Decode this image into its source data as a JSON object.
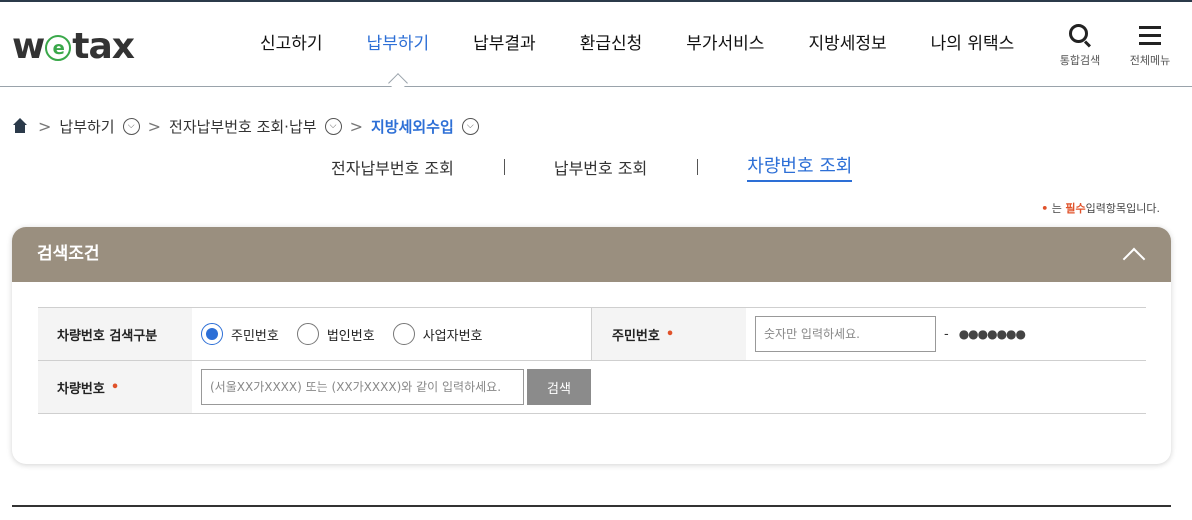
{
  "header": {
    "logo_pre": "w",
    "logo_e": "e",
    "logo_post": "tax",
    "nav": [
      "신고하기",
      "납부하기",
      "납부결과",
      "환급신청",
      "부가서비스",
      "지방세정보",
      "나의 위택스"
    ],
    "active_nav": "납부하기",
    "search_label": "통합검색",
    "menu_label": "전체메뉴"
  },
  "breadcrumb": {
    "items": [
      "납부하기",
      "전자납부번호 조회·납부",
      "지방세외수입"
    ],
    "separator": ">"
  },
  "tabs": {
    "items": [
      "전자납부번호 조회",
      "납부번호 조회",
      "차량번호 조회"
    ],
    "active": "차량번호 조회"
  },
  "required_note": {
    "bullet": "•",
    "pre": "는",
    "highlight": "필수",
    "post": "입력항목입니다."
  },
  "panel": {
    "title": "검색조건",
    "form": {
      "row1": {
        "label": "차량번호 검색구분",
        "options": [
          "주민번호",
          "법인번호",
          "사업자번호"
        ],
        "selected": "주민번호",
        "id_label": "주민번호",
        "required_mark": "•",
        "id_placeholder": "숫자만 입력하세요.",
        "dash": "-",
        "masked": "●●●●●●●"
      },
      "row2": {
        "label": "차량번호",
        "required_mark": "•",
        "placeholder": "(서울XX가XXXX) 또는 (XX가XXXX)와 같이 입력하세요.",
        "search_button": "검색"
      }
    }
  },
  "colors": {
    "accent": "#2d6fd6",
    "panel_header": "#9a8f7f",
    "required": "#e0522a",
    "logo_e": "#3aa84a"
  }
}
